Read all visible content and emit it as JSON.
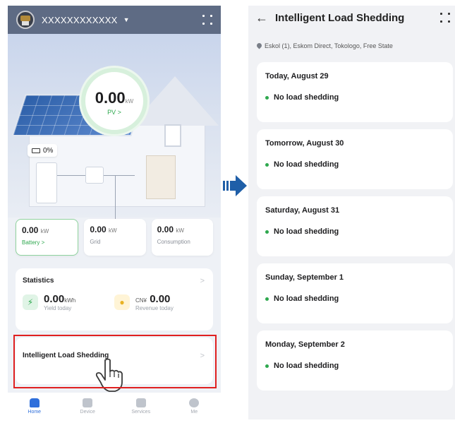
{
  "home": {
    "site_name": "XXXXXXXXXXXX",
    "pv": {
      "value": "0.00",
      "unit": "kW",
      "label": "PV >"
    },
    "soc": "0%",
    "cards": [
      {
        "value": "0.00",
        "unit": "kW",
        "label": "Battery >"
      },
      {
        "value": "0.00",
        "unit": "kW",
        "label": "Grid"
      },
      {
        "value": "0.00",
        "unit": "kW",
        "label": "Consumption"
      }
    ],
    "statistics": {
      "title": "Statistics",
      "chevron": ">",
      "yield": {
        "value": "0.00",
        "unit": "kWh",
        "label": "Yield today"
      },
      "revenue": {
        "prefix": "CN¥",
        "value": "0.00",
        "label": "Revenue today"
      }
    },
    "ils": {
      "label": "Intelligent Load Shedding",
      "chevron": ">"
    },
    "nav": [
      {
        "label": "Home"
      },
      {
        "label": "Device"
      },
      {
        "label": "Services"
      },
      {
        "label": "Me"
      }
    ]
  },
  "shedding": {
    "title": "Intelligent Load Shedding",
    "location": "Eskol (1), Eskom Direct, Tokologo, Free State",
    "days": [
      {
        "date": "Today, August 29",
        "status": "No load shedding"
      },
      {
        "date": "Tomorrow, August 30",
        "status": "No load shedding"
      },
      {
        "date": "Saturday, August 31",
        "status": "No load shedding"
      },
      {
        "date": "Sunday, September 1",
        "status": "No load shedding"
      },
      {
        "date": "Monday, September 2",
        "status": "No load shedding"
      }
    ]
  },
  "colors": {
    "accent_green": "#2ea84e",
    "nav_active": "#2f6fdb",
    "highlight_red": "#e02020",
    "arrow_blue": "#1f5fa8"
  },
  "icons": {
    "back": "←",
    "caret": "▼",
    "bolt": "⚡"
  }
}
